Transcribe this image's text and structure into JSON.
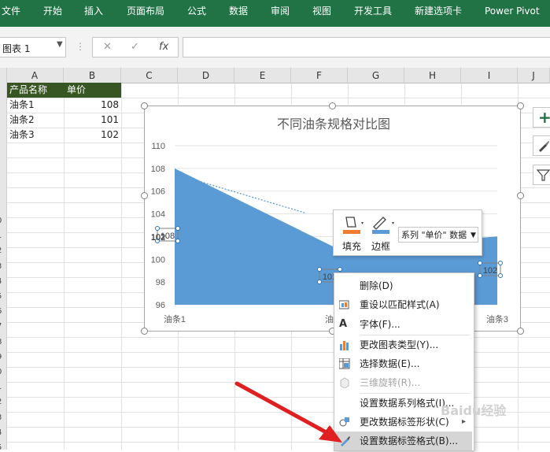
{
  "ribbon": {
    "tabs": [
      "文件",
      "开始",
      "插入",
      "页面布局",
      "公式",
      "数据",
      "审阅",
      "视图",
      "开发工具",
      "新建选项卡",
      "Power Pivot"
    ]
  },
  "formula_bar": {
    "name_box": "图表 1",
    "cancel_glyph": "✕",
    "enter_glyph": "✓",
    "fx_glyph": "fx",
    "formula_value": ""
  },
  "grid": {
    "columns": [
      "A",
      "B",
      "C",
      "D",
      "E",
      "F",
      "G",
      "H",
      "I",
      "J"
    ],
    "row_numbers": [
      "0",
      "1",
      "2",
      "3",
      "4",
      "5",
      "6",
      "7",
      "8",
      "9",
      "0",
      "1",
      "2",
      "3",
      "4",
      "5",
      "6",
      "7",
      "8",
      "9"
    ],
    "header_row": {
      "a": "产品名称",
      "b": "单价"
    },
    "rows": [
      {
        "a": "油条1",
        "b": "108"
      },
      {
        "a": "油条2",
        "b": "101"
      },
      {
        "a": "油条3",
        "b": "102"
      }
    ]
  },
  "chart": {
    "fill_color": "#5b9bd5",
    "side_buttons": [
      "plus-icon",
      "brush-icon",
      "filter-icon"
    ]
  },
  "chart_data": {
    "type": "area",
    "title": "不同油条规格对比图",
    "categories": [
      "油条1",
      "油条2",
      "油条3"
    ],
    "series": [
      {
        "name": "单价",
        "values": [
          108,
          101,
          102
        ]
      }
    ],
    "ylim": [
      96,
      110
    ],
    "yticks": [
      "96",
      "98",
      "100",
      "102",
      "104",
      "106",
      "108",
      "110"
    ],
    "xlabel": "",
    "ylabel": "",
    "data_labels": [
      "108",
      "101",
      "102"
    ],
    "extra_label": "102",
    "grid": true,
    "legend": "none"
  },
  "mini_toolbar": {
    "fill_label": "填充",
    "border_label": "边框",
    "series_select": "系列 \"单价\" 数据"
  },
  "context_menu": {
    "items": [
      {
        "label": "删除(D)",
        "icon": "none",
        "disabled": false
      },
      {
        "label": "重设以匹配样式(A)",
        "icon": "reset-style-icon",
        "disabled": false
      },
      {
        "label": "字体(F)...",
        "icon": "font-a-icon",
        "disabled": false
      },
      {
        "label": "更改图表类型(Y)...",
        "icon": "chart-type-icon",
        "disabled": false
      },
      {
        "label": "选择数据(E)...",
        "icon": "select-data-icon",
        "disabled": false
      },
      {
        "label": "三维旋转(R)...",
        "icon": "rotate-3d-icon",
        "disabled": true
      },
      {
        "label": "设置数据系列格式(I)...",
        "icon": "none",
        "disabled": false
      },
      {
        "label": "更改数据标签形状(C)",
        "icon": "shape-icon",
        "disabled": false,
        "submenu": true
      },
      {
        "label": "设置数据标签格式(B)...",
        "icon": "format-label-icon",
        "disabled": false,
        "highlighted": true
      }
    ],
    "submenu_arrow": "▸"
  },
  "watermark": "Baidu经验"
}
